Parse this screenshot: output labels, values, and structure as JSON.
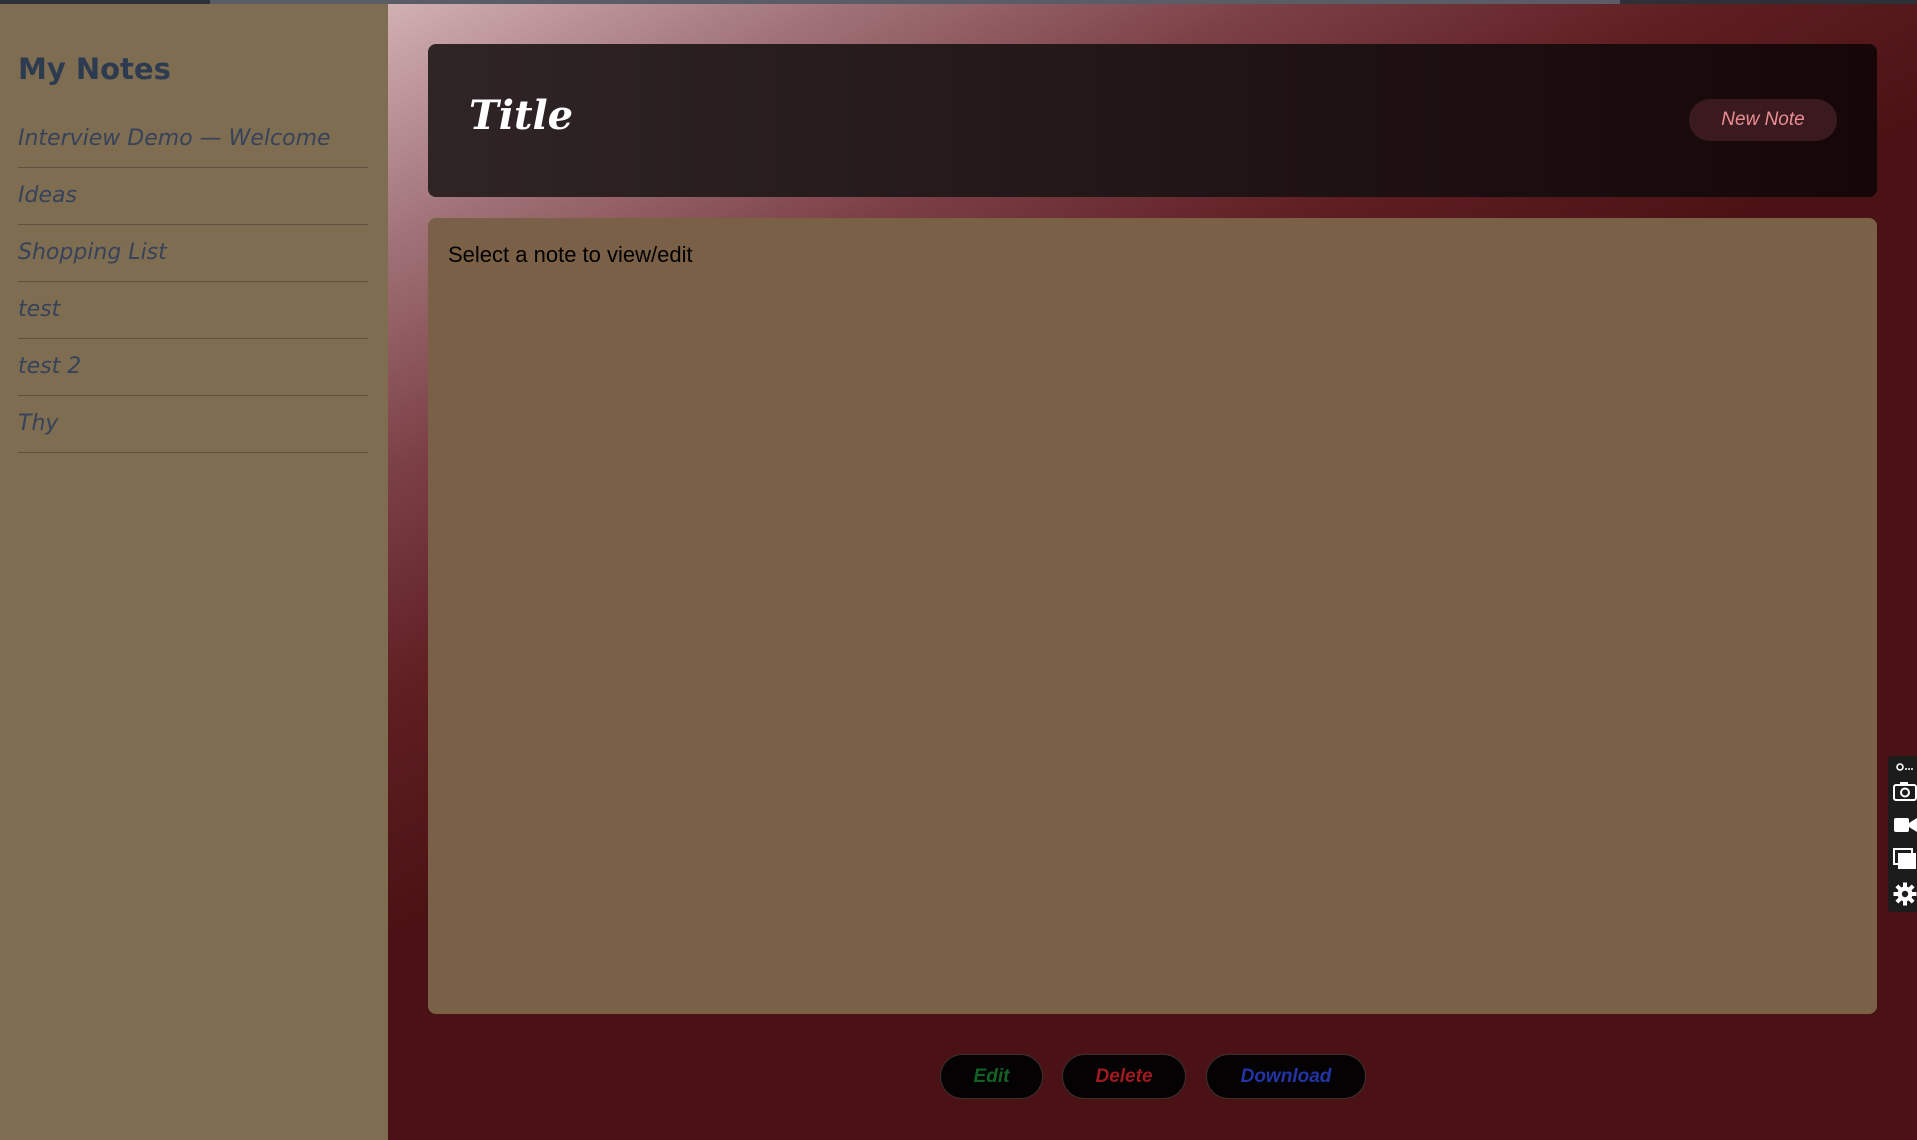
{
  "sidebar": {
    "title": "My Notes",
    "notes": [
      {
        "label": "Interview Demo — Welcome"
      },
      {
        "label": "Ideas"
      },
      {
        "label": "Shopping List"
      },
      {
        "label": "test"
      },
      {
        "label": "test 2"
      },
      {
        "label": "Thy"
      }
    ]
  },
  "header": {
    "title": "Title",
    "new_note_label": "New Note"
  },
  "content": {
    "placeholder": "Select a note to view/edit"
  },
  "actions": {
    "edit_label": "Edit",
    "delete_label": "Delete",
    "download_label": "Download"
  },
  "floating_toolbar": {
    "icons": [
      "link-icon",
      "camera-icon",
      "video-icon",
      "window-icon",
      "gear-icon"
    ]
  },
  "colors": {
    "sidebar_bg": "#7f6d51",
    "main_bg": "#4a1214",
    "content_bg": "#7a6046",
    "edit_text": "#136225",
    "delete_text": "#a01b1f",
    "download_text": "#2234a6",
    "new_note_text": "#ea8e94"
  }
}
